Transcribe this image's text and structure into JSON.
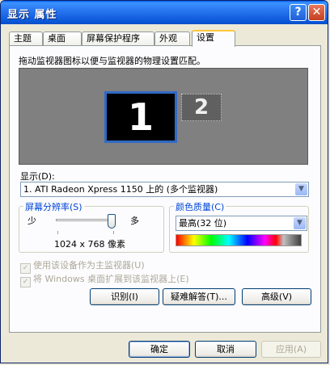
{
  "window": {
    "title": "显示 属性",
    "help_glyph": "?",
    "close_glyph": "✕"
  },
  "tabs": [
    {
      "label": "主题"
    },
    {
      "label": "桌面"
    },
    {
      "label": "屏幕保护程序"
    },
    {
      "label": "外观"
    },
    {
      "label": "设置",
      "active": true
    }
  ],
  "settings": {
    "instruction": "拖动监视器图标以便与监视器的物理设置匹配。",
    "monitors": [
      {
        "number": "1",
        "selected": true
      },
      {
        "number": "2",
        "selected": false
      }
    ],
    "display_label": "显示(D):",
    "display_value": "1. ATI Radeon Xpress 1150 上的 (多个监视器)",
    "resolution": {
      "title": "屏幕分辨率(S)",
      "less": "少",
      "more": "多",
      "value": "1024 x 768 像素"
    },
    "color_quality": {
      "title": "颜色质量(C)",
      "value": "最高(32 位)"
    },
    "checkboxes": [
      {
        "label": "使用该设备作为主监视器(U)",
        "checked": true,
        "disabled": true
      },
      {
        "label": "将 Windows 桌面扩展到该监视器上(E)",
        "checked": true,
        "disabled": true
      }
    ],
    "buttons": {
      "identify": "识别(I)",
      "troubleshoot": "疑难解答(T)...",
      "advanced": "高级(V)"
    }
  },
  "footer": {
    "ok": "确定",
    "cancel": "取消",
    "apply": "应用(A)"
  },
  "colors": {
    "title_bar": "#0A57D9",
    "accent": "#FFC73C",
    "monitor_area": "#808080",
    "selection_border": "#3169C6"
  }
}
